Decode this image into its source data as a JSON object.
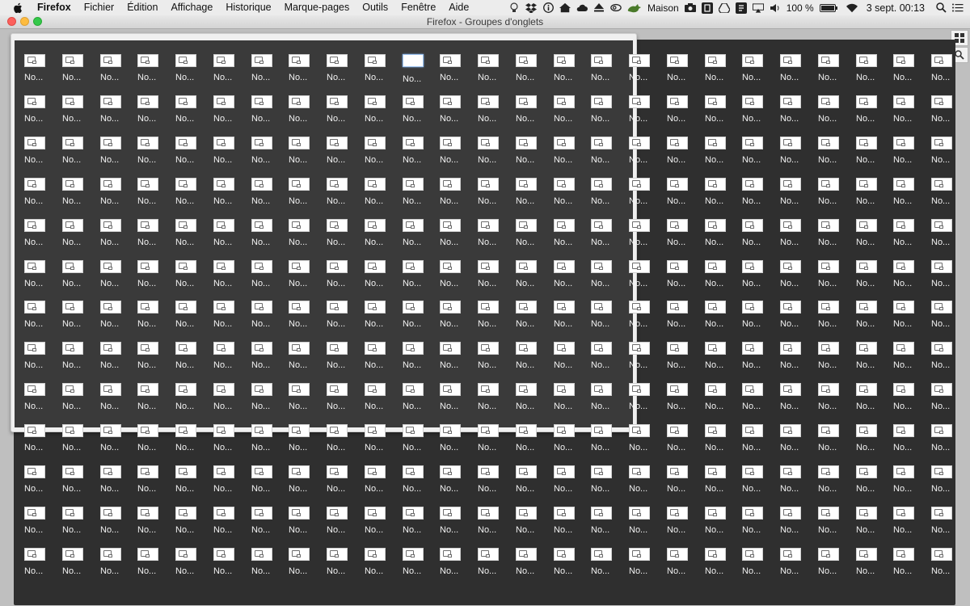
{
  "menubar": {
    "app_name": "Firefox",
    "menus": [
      "Fichier",
      "Édition",
      "Affichage",
      "Historique",
      "Marque-pages",
      "Outils",
      "Fenêtre",
      "Aide"
    ],
    "status_label": "Maison",
    "battery_text": "100 %",
    "clock_text": "3 sept.  00:13",
    "icons": [
      "lightbulb-icon",
      "dropbox-icon",
      "info-icon",
      "home-icon",
      "cloud-sync-icon",
      "eject-icon",
      "creative-cloud-icon",
      "growl-icon",
      "camera-icon",
      "mirror-icon",
      "drive-icon",
      "notes-icon",
      "airplay-icon",
      "volume-icon",
      "battery-icon",
      "wifi-icon",
      "spotlight-icon",
      "notification-center-icon"
    ]
  },
  "window": {
    "title": "Firefox - Groupes d'onglets"
  },
  "tab_groups": {
    "tab_label": "No...",
    "columns": 25,
    "rows": 13,
    "active_tab": {
      "row": 1,
      "col": 11
    }
  },
  "colors": {
    "canvas_background": "#2f2f2f",
    "panel_background": "#f0f0f0",
    "active_highlight": "#9fc4f2"
  }
}
